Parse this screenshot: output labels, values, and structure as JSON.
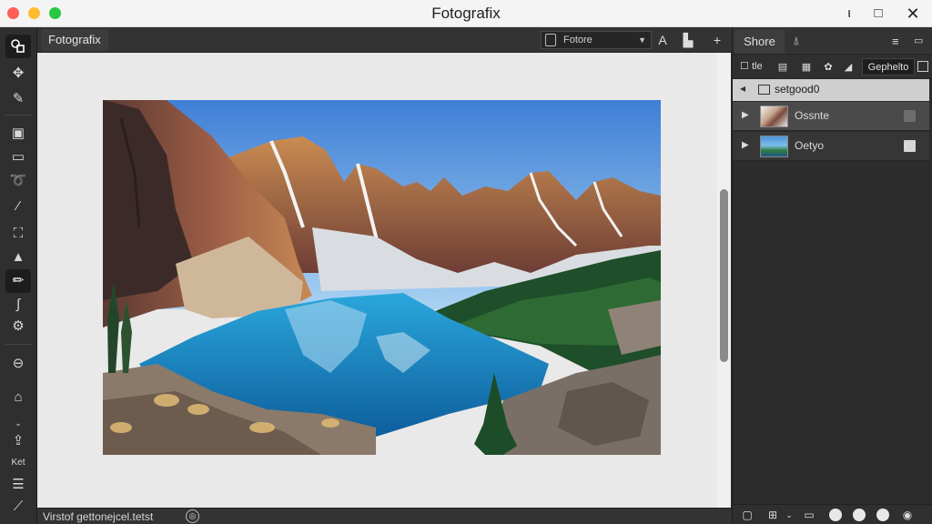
{
  "app": {
    "title": "Fotografix"
  },
  "window_controls": {
    "minimize_glyph": "ι",
    "maximize_glyph": "□",
    "close_glyph": "✕"
  },
  "document": {
    "tab_label": "Fotografix",
    "preset_value": "Fotore",
    "status_text": "Virstof gettonejcel.tetst"
  },
  "tools": {
    "text_label": "Ket"
  },
  "right_panel": {
    "active_tab": "Shore",
    "blend_mode": "Gephelto",
    "toolbar_label": "tle",
    "group_name": "setgood0",
    "layers": [
      {
        "name": "Ossnte",
        "selected": true
      },
      {
        "name": "Oetyo",
        "selected": false
      }
    ]
  },
  "colors": {
    "accent_dark": "#2b2b2b",
    "canvas_bg": "#e9e9e9",
    "selection": "#cfcfcf"
  },
  "icons": [
    "select-shapes-icon",
    "move-icon",
    "brush-icon",
    "crop-icon",
    "marquee-icon",
    "lasso-icon",
    "eyedropper-icon",
    "clone-icon",
    "arrow-up-icon",
    "pencil-icon",
    "curve-icon",
    "gear-icon",
    "minus-circle-icon",
    "bookmark-icon",
    "export-icon",
    "sliders-icon",
    "picker-icon"
  ]
}
